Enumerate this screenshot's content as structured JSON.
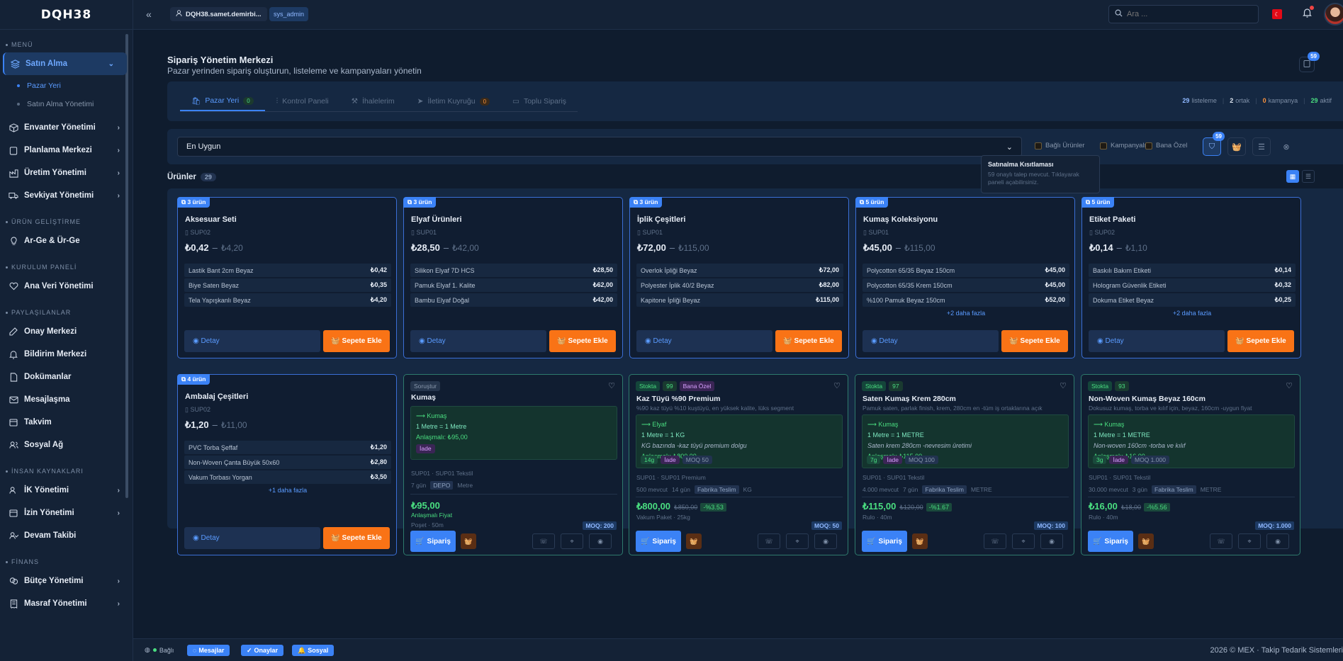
{
  "app": {
    "logo": "DQH38"
  },
  "topbar": {
    "user": "DQH38.samet.demirbi...",
    "role": "sys_admin",
    "search_placeholder": "Ara ..."
  },
  "sidebar": {
    "menu_label": "MENÜ",
    "satin_alma": "Satın Alma",
    "sub_pazar": "Pazar Yeri",
    "sub_yonetim": "Satın Alma Yönetimi",
    "envanter": "Envanter Yönetimi",
    "planlama": "Planlama Merkezi",
    "uretim": "Üretim Yönetimi",
    "sevkiyat": "Sevkiyat Yönetimi",
    "urun_gel": "ÜRÜN GELİŞTİRME",
    "arge": "Ar-Ge & Ür-Ge",
    "kurulum": "KURULUM PANELİ",
    "ana_veri": "Ana Veri Yönetimi",
    "paylasilan": "PAYLAŞILANLAR",
    "onay": "Onay Merkezi",
    "bildirim": "Bildirim Merkezi",
    "dokuman": "Dokümanlar",
    "mesaj": "Mesajlaşma",
    "takvim": "Takvim",
    "sosyal": "Sosyal Ağ",
    "insan": "İNSAN KAYNAKLARI",
    "ik": "İK Yönetimi",
    "izin": "İzin Yönetimi",
    "devam": "Devam Takibi",
    "finans": "FİNANS",
    "butce": "Bütçe Yönetimi",
    "masraf": "Masraf Yönetimi"
  },
  "page": {
    "title": "Sipariş Yönetim Merkezi",
    "subtitle": "Pazar yerinden sipariş oluşturun, listeleme ve kampanyaları yönetin",
    "cart_count": "59"
  },
  "tabs": [
    {
      "label": "Pazar Yeri",
      "count": "0"
    },
    {
      "label": "Kontrol Paneli"
    },
    {
      "label": "İhalelerim"
    },
    {
      "label": "İletim Kuyruğu",
      "count": "0"
    },
    {
      "label": "Toplu Sipariş"
    }
  ],
  "stats": {
    "listeleme_n": "29",
    "listeleme": "listeleme",
    "ortak_n": "2",
    "ortak": "ortak",
    "kampanya_n": "0",
    "kampanya": "kampanya",
    "aktif_n": "29",
    "aktif": "aktif"
  },
  "filter": {
    "sort": "En Uygun",
    "bagli": "Bağlı Ürünler",
    "kampanyali": "Kampanyalı",
    "bana_ozel": "Bana Özel",
    "restrict_count": "59"
  },
  "tooltip": {
    "title": "Satınalma Kısıtlaması",
    "desc": "59 onaylı talep mevcut. Tıklayarak paneli açabilirsiniz."
  },
  "products_header": {
    "label": "Ürünler",
    "count": "29"
  },
  "groups": [
    {
      "badge": "3 ürün",
      "name": "Aksesuar Seti",
      "sup": "SUP02",
      "min": "₺0,42",
      "max": "₺4,20",
      "items": [
        {
          "n": "Lastik Bant 2cm Beyaz",
          "p": "₺0,42"
        },
        {
          "n": "Biye Saten Beyaz",
          "p": "₺0,35"
        },
        {
          "n": "Tela Yapışkanlı Beyaz",
          "p": "₺4,20"
        }
      ],
      "more": ""
    },
    {
      "badge": "3 ürün",
      "name": "Elyaf Ürünleri",
      "sup": "SUP01",
      "min": "₺28,50",
      "max": "₺42,00",
      "items": [
        {
          "n": "Silikon Elyaf 7D HCS",
          "p": "₺28,50"
        },
        {
          "n": "Pamuk Elyaf 1. Kalite",
          "p": "₺62,00"
        },
        {
          "n": "Bambu Elyaf Doğal",
          "p": "₺42,00"
        }
      ],
      "more": ""
    },
    {
      "badge": "3 ürün",
      "name": "İplik Çeşitleri",
      "sup": "SUP01",
      "min": "₺72,00",
      "max": "₺115,00",
      "items": [
        {
          "n": "Overlok İpliği Beyaz",
          "p": "₺72,00"
        },
        {
          "n": "Polyester İplik 40/2 Beyaz",
          "p": "₺82,00"
        },
        {
          "n": "Kapitone İpliği Beyaz",
          "p": "₺115,00"
        }
      ],
      "more": ""
    },
    {
      "badge": "5 ürün",
      "name": "Kumaş Koleksiyonu",
      "sup": "SUP01",
      "min": "₺45,00",
      "max": "₺115,00",
      "items": [
        {
          "n": "Polycotton 65/35 Beyaz 150cm",
          "p": "₺45,00"
        },
        {
          "n": "Polycotton 65/35 Krem 150cm",
          "p": "₺45,00"
        },
        {
          "n": "%100 Pamuk Beyaz 150cm",
          "p": "₺52,00"
        }
      ],
      "more": "+2 daha fazla"
    },
    {
      "badge": "5 ürün",
      "name": "Etiket Paketi",
      "sup": "SUP02",
      "min": "₺0,14",
      "max": "₺1,10",
      "items": [
        {
          "n": "Baskılı Bakım Etiketi",
          "p": "₺0,14"
        },
        {
          "n": "Hologram Güvenlik Etiketi",
          "p": "₺0,32"
        },
        {
          "n": "Dokuma Etiket Beyaz",
          "p": "₺0,25"
        }
      ],
      "more": "+2 daha fazla"
    },
    {
      "badge": "4 ürün",
      "name": "Ambalaj Çeşitleri",
      "sup": "SUP02",
      "min": "₺1,20",
      "max": "₺11,00",
      "items": [
        {
          "n": "PVC Torba Şeffaf",
          "p": "₺1,20"
        },
        {
          "n": "Non-Woven Çanta Büyük 50x60",
          "p": "₺2,80"
        },
        {
          "n": "Vakum Torbası Yorgan",
          "p": "₺3,50"
        }
      ],
      "more": "+1 daha fazla"
    }
  ],
  "card_labels": {
    "detay": "Detay",
    "ekle": "Sepete Ekle",
    "siparis": "Sipariş"
  },
  "p_kumas": {
    "tag": "Soruştur",
    "name": "Kumaş",
    "g1": "⟶ Kumaş",
    "g2": "1 Metre = 1 Metre",
    "g3": "Anlaşmalı: ₺95,00",
    "c": "İade",
    "sup": "SUP01 · SUP01 Tekstil",
    "lead": "7 gün",
    "depo": "DEPO",
    "unit": "Metre",
    "price": "₺95,00",
    "pl": "Anlaşmalı Fiyat",
    "pack": "Poşet · 50m",
    "moq": "MOQ: 200"
  },
  "p_kaz": {
    "stok": "Stokta",
    "q": "99",
    "b": "Bana Özel",
    "name": "Kaz Tüyü %90 Premium",
    "desc": "%90 kaz tüyü %10 kuştüyü, en yüksek kalite, lüks segment",
    "g1": "⟶ Elyaf",
    "g2": "1 Metre = 1 KG",
    "g3": "KG bazında -kaz tüyü premium dolgu",
    "g4": "Anlaşmalı: ₺800,00",
    "c1": "14g",
    "c2": "İade",
    "c3": "MOQ 50",
    "sup": "SUP01 · SUP01 Premium",
    "m1": "500 mevcut",
    "m2": "14 gün",
    "ft": "Fabrika Teslim",
    "unit": "KG",
    "price": "₺800,00",
    "old": "₺850,00",
    "pct": "-%3.53",
    "pack": "Vakum Paket · 25kg",
    "moq": "MOQ: 50"
  },
  "p_saten": {
    "stok": "Stokta",
    "q": "97",
    "name": "Saten Kumaş Krem 280cm",
    "desc": "Pamuk saten, parlak finish, krem, 280cm en -tüm iş ortaklarına açık",
    "g1": "⟶ Kumaş",
    "g2": "1 Metre = 1 METRE",
    "g3": "Saten krem 280cm -nevresim üretimi",
    "g4": "Anlaşmalı: ₺115,00",
    "c1": "7g",
    "c2": "İade",
    "c3": "MOQ 100",
    "sup": "SUP01 · SUP01 Tekstil",
    "m1": "4.000 mevcut",
    "m2": "7 gün",
    "ft": "Fabrika Teslim",
    "unit": "METRE",
    "price": "₺115,00",
    "old": "₺120,00",
    "pct": "-%1.67",
    "pack": "Rulo · 40m",
    "moq": "MOQ: 100"
  },
  "p_nonwoven": {
    "stok": "Stokta",
    "q": "93",
    "name": "Non-Woven Kumaş Beyaz 160cm",
    "desc": "Dokusuz kumaş, torba ve kılıf için, beyaz, 160cm -uygun fiyat",
    "g1": "⟶ Kumaş",
    "g2": "1 Metre = 1 METRE",
    "g3": "Non-woven 160cm -torba ve kılıf",
    "g4": "Anlaşmalı: ₺16,00",
    "c1": "3g",
    "c2": "İade",
    "c3": "MOQ 1.000",
    "sup": "SUP01 · SUP01 Tekstil",
    "m1": "30.000 mevcut",
    "m2": "3 gün",
    "ft": "Fabrika Teslim",
    "unit": "METRE",
    "price": "₺16,00",
    "old": "₺18,00",
    "pct": "-%5.56",
    "pack": "Rulo · 40m",
    "moq": "MOQ: 1.000"
  },
  "footer": {
    "status": "Bağlı",
    "mesajlar": "Mesajlar",
    "onaylar": "Onaylar",
    "sosyal": "Sosyal",
    "right": "2026 © MEX · Takip Tedarik Sistemleri"
  }
}
